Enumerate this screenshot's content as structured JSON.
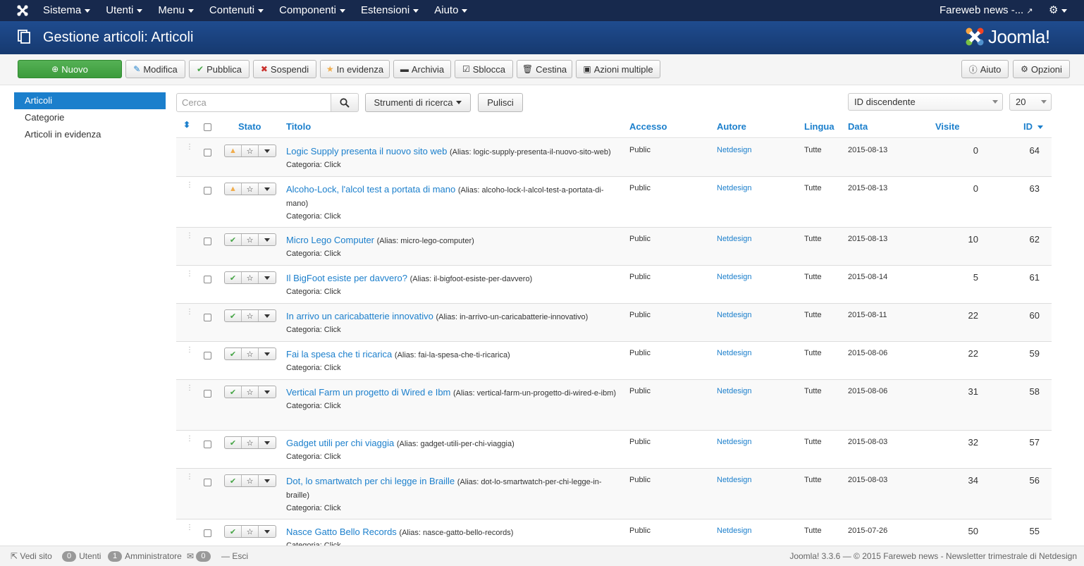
{
  "topnav": {
    "menu": [
      "Sistema",
      "Utenti",
      "Menu",
      "Contenuti",
      "Componenti",
      "Estensioni",
      "Aiuto"
    ],
    "site_name": "Fareweb news -..."
  },
  "header": {
    "title": "Gestione articoli: Articoli",
    "brand": "Joomla!"
  },
  "toolbar": {
    "new": "Nuovo",
    "edit": "Modifica",
    "publish": "Pubblica",
    "unpublish": "Sospendi",
    "featured": "In evidenza",
    "archive": "Archivia",
    "checkin": "Sblocca",
    "trash": "Cestina",
    "batch": "Azioni multiple",
    "help": "Aiuto",
    "options": "Opzioni"
  },
  "sidebar": {
    "items": [
      {
        "label": "Articoli",
        "active": true
      },
      {
        "label": "Categorie",
        "active": false
      },
      {
        "label": "Articoli in evidenza",
        "active": false
      }
    ]
  },
  "filters": {
    "search_placeholder": "Cerca",
    "search_tools": "Strumenti di ricerca",
    "clear": "Pulisci",
    "ordering": "ID discendente",
    "limit": "20"
  },
  "table": {
    "headers": {
      "status": "Stato",
      "title": "Titolo",
      "access": "Accesso",
      "author": "Autore",
      "language": "Lingua",
      "date": "Data",
      "hits": "Visite",
      "id": "ID"
    },
    "rows": [
      {
        "title": "Logic Supply presenta il nuovo sito web",
        "alias": "(Alias: logic-supply-presenta-il-nuovo-sito-web)",
        "category": "Categoria: Click",
        "access": "Public",
        "author": "Netdesign",
        "language": "Tutte",
        "date": "2015-08-13",
        "hits": "0",
        "id": "64",
        "status": "warning"
      },
      {
        "title": "Alcoho-Lock, l'alcol test a portata di mano",
        "alias": "(Alias: alcoho-lock-l-alcol-test-a-portata-di-mano)",
        "category": "Categoria: Click",
        "access": "Public",
        "author": "Netdesign",
        "language": "Tutte",
        "date": "2015-08-13",
        "hits": "0",
        "id": "63",
        "status": "warning"
      },
      {
        "title": "Micro Lego Computer",
        "alias": "(Alias: micro-lego-computer)",
        "category": "Categoria: Click",
        "access": "Public",
        "author": "Netdesign",
        "language": "Tutte",
        "date": "2015-08-13",
        "hits": "10",
        "id": "62",
        "status": "published"
      },
      {
        "title": "Il BigFoot esiste per davvero?",
        "alias": "(Alias: il-bigfoot-esiste-per-davvero)",
        "category": "Categoria: Click",
        "access": "Public",
        "author": "Netdesign",
        "language": "Tutte",
        "date": "2015-08-14",
        "hits": "5",
        "id": "61",
        "status": "published"
      },
      {
        "title": "In arrivo un caricabatterie innovativo",
        "alias": "(Alias: in-arrivo-un-caricabatterie-innovativo)",
        "category": "Categoria: Click",
        "access": "Public",
        "author": "Netdesign",
        "language": "Tutte",
        "date": "2015-08-11",
        "hits": "22",
        "id": "60",
        "status": "published"
      },
      {
        "title": "Fai la spesa che ti ricarica",
        "alias": "(Alias: fai-la-spesa-che-ti-ricarica)",
        "category": "Categoria: Click",
        "access": "Public",
        "author": "Netdesign",
        "language": "Tutte",
        "date": "2015-08-06",
        "hits": "22",
        "id": "59",
        "status": "published"
      },
      {
        "title": "Vertical Farm un progetto di Wired e Ibm",
        "alias": "(Alias: vertical-farm-un-progetto-di-wired-e-ibm)",
        "category": "Categoria: Click",
        "access": "Public",
        "author": "Netdesign",
        "language": "Tutte",
        "date": "2015-08-06",
        "hits": "31",
        "id": "58",
        "status": "published"
      },
      {
        "title": "Gadget utili per chi viaggia",
        "alias": "(Alias: gadget-utili-per-chi-viaggia)",
        "category": "Categoria: Click",
        "access": "Public",
        "author": "Netdesign",
        "language": "Tutte",
        "date": "2015-08-03",
        "hits": "32",
        "id": "57",
        "status": "published"
      },
      {
        "title": "Dot, lo smartwatch per chi legge in Braille",
        "alias": "(Alias: dot-lo-smartwatch-per-chi-legge-in-braille)",
        "category": "Categoria: Click",
        "access": "Public",
        "author": "Netdesign",
        "language": "Tutte",
        "date": "2015-08-03",
        "hits": "34",
        "id": "56",
        "status": "published"
      },
      {
        "title": "Nasce Gatto Bello Records",
        "alias": "(Alias: nasce-gatto-bello-records)",
        "category": "Categoria: Click",
        "access": "Public",
        "author": "Netdesign",
        "language": "Tutte",
        "date": "2015-07-26",
        "hits": "50",
        "id": "55",
        "status": "published"
      }
    ]
  },
  "footer": {
    "view_site": "Vedi sito",
    "users_count": "0",
    "users_label": "Utenti",
    "admin_count": "1",
    "admin_label": "Amministratore",
    "messages_count": "0",
    "logout": "Esci",
    "copyright": "Joomla! 3.3.6  —  © 2015 Fareweb news - Newsletter trimestrale di Netdesign"
  }
}
